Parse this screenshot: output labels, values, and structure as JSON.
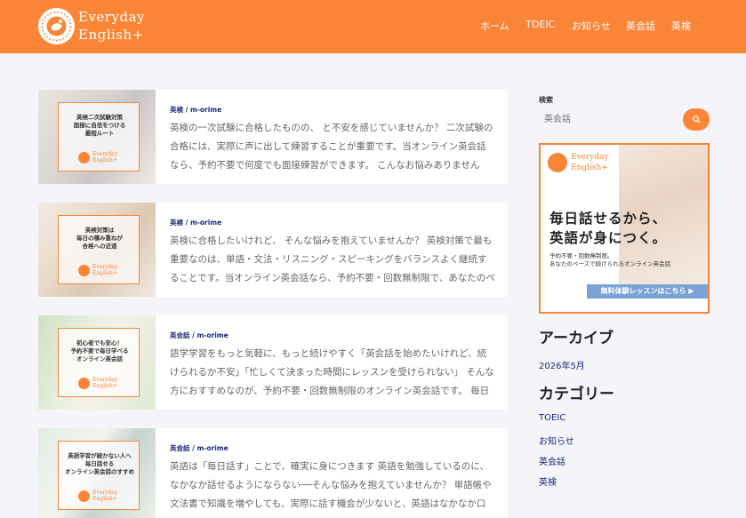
{
  "site": {
    "logo_line1": "Everyday",
    "logo_line2": "English+",
    "brand_color": "#fb8537",
    "nav": [
      "ホーム",
      "TOEIC",
      "お知らせ",
      "英会話",
      "英検"
    ]
  },
  "posts": [
    {
      "thumb_title": "英検二次試験対策\n面接に自信をつける\n最短ルート",
      "thumb_logo_1": "Everyday",
      "thumb_logo_2": "English+",
      "meta": "英検 / m-orime",
      "excerpt": "英検の一次試験に合格したものの、 と不安を感じていませんか？ 二次試験の合格には、実際に声に出して練習することが重要です。当オンライン英会話なら、予約不要で何度でも面接練習ができます。 こんなお悩みありませんか？ ..."
    },
    {
      "thumb_title": "英検対策は\n毎日の積み重ねが\n合格への近道",
      "thumb_logo_1": "Everyday",
      "thumb_logo_2": "English+",
      "meta": "英検 / m-orime",
      "excerpt": "英検に合格したいけれど、 そんな悩みを抱えていませんか？ 英検対策で最も重要なのは、単語・文法・リスニング・スピーキングをバランスよく継続することです。当オンライン英会話なら、予約不要・回数無制限で、あなたのペー..."
    },
    {
      "thumb_title": "初心者でも安心！\n予約不要で毎日学べる\nオンライン英会話",
      "thumb_logo_1": "Everyday",
      "thumb_logo_2": "English+",
      "meta": "英会話 / m-orime",
      "excerpt": "語学学習をもっと気軽に、もっと続けやすく「英会話を始めたいけれど、続けられるか不安」「忙しくて決まった時間にレッスンを受けられない」 そんな方におすすめなのが、予約不要・回数無制限のオンライン英会話です。 毎日好き..."
    },
    {
      "thumb_title": "英語学習が続かない人へ\n毎日話せる\nオンライン英会話のすすめ",
      "thumb_logo_1": "Everyday",
      "thumb_logo_2": "English+",
      "meta": "英会話 / m-orime",
      "excerpt": "英語は「毎日話す」ことで、確実に身につきます 英語を勉強しているのに、なかなか話せるようにならない──そんな悩みを抱えていませんか？ 単語帳や文法書で知識を増やしても、実際に話す機会が少ないと、英語はなかなか口か..."
    }
  ],
  "sidebar": {
    "search_label": "検索",
    "search_placeholder": "英会話",
    "search_icon": "search-icon",
    "banner": {
      "logo_line1": "Everyday",
      "logo_line2": "English+",
      "headline_1": "毎日話せるから、",
      "headline_2": "英語が身につく。",
      "sub_1": "予約不要・回数無制限。",
      "sub_2": "あなたのペースで続けられるオンライン英会話",
      "cta": "無料体験レッスンはこちら ▶"
    },
    "archive_heading": "アーカイブ",
    "archive_items": [
      "2026年5月"
    ],
    "category_heading": "カテゴリー",
    "category_items": [
      "TOEIC",
      "お知らせ",
      "英会話",
      "英検"
    ]
  }
}
